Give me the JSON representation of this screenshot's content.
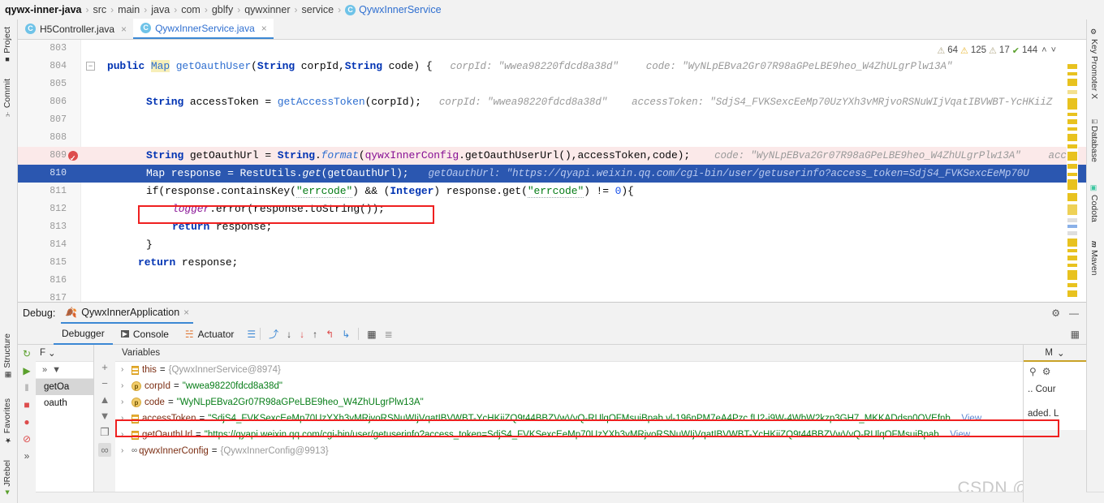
{
  "breadcrumb": {
    "items": [
      {
        "label": "qywx-inner-java",
        "kind": "root"
      },
      {
        "label": "src",
        "kind": "plain"
      },
      {
        "label": "main",
        "kind": "plain"
      },
      {
        "label": "java",
        "kind": "plain"
      },
      {
        "label": "com",
        "kind": "plain"
      },
      {
        "label": "gblfy",
        "kind": "plain"
      },
      {
        "label": "qywxinner",
        "kind": "plain"
      },
      {
        "label": "service",
        "kind": "plain"
      },
      {
        "label": "QywxInnerService",
        "kind": "class"
      }
    ],
    "separator": "›",
    "class_badge": "C"
  },
  "left_rail": [
    {
      "label": "Project",
      "icon": "project-icon",
      "glyph": "■"
    },
    {
      "label": "Commit",
      "icon": "commit-icon",
      "glyph": "⑂"
    },
    {
      "label": "Structure",
      "icon": "structure-icon",
      "glyph": "▦"
    },
    {
      "label": "Favorites",
      "icon": "star-icon",
      "glyph": "★"
    },
    {
      "label": "JRebel",
      "icon": "jrebel-icon",
      "glyph": "▲"
    }
  ],
  "right_rail": [
    {
      "label": "Key Promoter X",
      "icon": "key-promoter-icon",
      "glyph": "⚙"
    },
    {
      "label": "Database",
      "icon": "database-icon",
      "glyph": "⌸"
    },
    {
      "label": "Codota",
      "icon": "codota-icon",
      "glyph": "▣"
    },
    {
      "label": "Maven",
      "icon": "maven-icon",
      "glyph": "m"
    }
  ],
  "editor_tabs": [
    {
      "label": "H5Controller.java",
      "badge": "C",
      "active": false,
      "close": "×"
    },
    {
      "label": "QywxInnerService.java",
      "badge": "C",
      "active": true,
      "close": "×"
    }
  ],
  "inspections": {
    "grey_1": "64",
    "yellow": "125",
    "grey_2": "17",
    "green": "144",
    "up": "˄",
    "down": "˅",
    "triangle_glyph": "⚠",
    "check_glyph": "✔"
  },
  "code": {
    "lines": [
      {
        "n": "803",
        "segments": [],
        "hint": ""
      },
      {
        "n": "804",
        "fold": "−",
        "segments": [
          {
            "t": "public ",
            "c": "kw"
          },
          {
            "t": "Map",
            "c": "ty hl-map"
          },
          {
            "t": " ",
            "c": ""
          },
          {
            "t": "getOauthUser",
            "c": "mi"
          },
          {
            "t": "(",
            "c": ""
          },
          {
            "t": "String",
            "c": "kw"
          },
          {
            "t": "  corpId,",
            "c": ""
          },
          {
            "t": "String",
            "c": "kw"
          },
          {
            "t": " code) {",
            "c": ""
          }
        ],
        "hints": [
          {
            "t": "corpId:  \"wwea98220fdcd8a38d\"",
            "pad": 22
          },
          {
            "t": "code:  \"WyNLpEBva2Gr07R98aGPeLBE9heo_W4ZhULgrPlw13A\"",
            "pad": 34
          }
        ]
      },
      {
        "n": "805",
        "segments": [],
        "hint": ""
      },
      {
        "n": "806",
        "indent": 4,
        "segments": [
          {
            "t": "String",
            "c": "kw"
          },
          {
            "t": " accessToken = ",
            "c": ""
          },
          {
            "t": "getAccessToken",
            "c": "mi"
          },
          {
            "t": "(corpId);",
            "c": ""
          }
        ],
        "hints": [
          {
            "t": "corpId:  \"wwea98220fdcd8a38d\"",
            "pad": 22
          },
          {
            "t": "accessToken:  \"SdjS4_FVKSexcEeMp70UzYXh3vMRjvoRSNuWIjVqatIBVWBT-YcHKiiZ",
            "pad": 30
          }
        ]
      },
      {
        "n": "807",
        "segments": [],
        "hint": ""
      },
      {
        "n": "808",
        "segments": [],
        "hint": ""
      },
      {
        "n": "809",
        "error": true,
        "breakpoint": true,
        "indent": 4,
        "segments": [
          {
            "t": "String",
            "c": "kw"
          },
          {
            "t": " getOauthUrl = ",
            "c": ""
          },
          {
            "t": "String",
            "c": "kw"
          },
          {
            "t": ".",
            "c": ""
          },
          {
            "t": "format",
            "c": "mi itl"
          },
          {
            "t": "(",
            "c": ""
          },
          {
            "t": "qywxInnerConfig",
            "c": "fld"
          },
          {
            "t": ".getOauthUserUrl(),accessToken,code);",
            "c": ""
          }
        ],
        "hints": [
          {
            "t": "code:  \"WyNLpEBva2Gr07R98aGPeLBE9heo_W4ZhULgrPlw13A\"",
            "pad": 30
          },
          {
            "t": "acc",
            "pad": 34
          }
        ]
      },
      {
        "n": "810",
        "current": true,
        "indent": 4,
        "segments": [
          {
            "t": "Map",
            "c": "ty"
          },
          {
            "t": "  response = ",
            "c": ""
          },
          {
            "t": "RestUtils",
            "c": "ty"
          },
          {
            "t": ".",
            "c": ""
          },
          {
            "t": "get",
            "c": "mi itl"
          },
          {
            "t": "(getOauthUrl);",
            "c": ""
          }
        ],
        "hints": [
          {
            "t": "getOauthUrl:  \"https://qyapi.weixin.qq.com/cgi-bin/user/getuserinfo?access_token=SdjS4_FVKSexcEeMp70U",
            "pad": 24
          }
        ]
      },
      {
        "n": "811",
        "indent": 4,
        "segments": [
          {
            "t": "if(response.containsKey(",
            "c": ""
          },
          {
            "t": "\"errcode\"",
            "c": "st"
          },
          {
            "t": ") && (",
            "c": ""
          },
          {
            "t": "Integer",
            "c": "kw"
          },
          {
            "t": ") response.get(",
            "c": ""
          },
          {
            "t": "\"errcode\"",
            "c": "st"
          },
          {
            "t": ") != ",
            "c": ""
          },
          {
            "t": "0",
            "c": "num"
          },
          {
            "t": "){",
            "c": ""
          }
        ],
        "hints": []
      },
      {
        "n": "812",
        "indent": 8,
        "segments": [
          {
            "t": "logger",
            "c": "fld itl"
          },
          {
            "t": ".error(response.toString());",
            "c": ""
          }
        ],
        "hints": []
      },
      {
        "n": "813",
        "indent": 8,
        "segments": [
          {
            "t": "return",
            "c": "kw"
          },
          {
            "t": "  response;",
            "c": ""
          }
        ],
        "hints": []
      },
      {
        "n": "814",
        "indent": 4,
        "segments": [
          {
            "t": "}",
            "c": ""
          }
        ],
        "hints": []
      },
      {
        "n": "815",
        "indent": 4,
        "segments": [
          {
            "t": "return",
            "c": "kw"
          },
          {
            "t": "  response;",
            "c": ""
          }
        ],
        "hints": []
      },
      {
        "n": "816",
        "segments": [],
        "hints": []
      },
      {
        "n": "817",
        "segments": [],
        "hints": []
      }
    ]
  },
  "debug": {
    "title_label": "Debug:",
    "run_config": "QywxInnerApplication",
    "close_glyph": "×",
    "settings_glyph": "⚙",
    "minimize_glyph": "—",
    "tabs": [
      {
        "label": "Debugger",
        "icon": "debugger-icon",
        "glyph": "",
        "active": true
      },
      {
        "label": "Console",
        "icon": "console-icon",
        "glyph": "▶",
        "active": false
      },
      {
        "label": "Actuator",
        "icon": "actuator-icon",
        "glyph": "☵",
        "active": false
      }
    ],
    "toolbar_icons": [
      {
        "name": "layout-icon",
        "glyph": "☰",
        "color": "#3c88d4"
      },
      {
        "name": "step-over-icon",
        "glyph": "⤴",
        "color": "#3c88d4"
      },
      {
        "name": "step-into-icon",
        "glyph": "↓",
        "color": "#3c3c3c"
      },
      {
        "name": "force-step-into-icon",
        "glyph": "↓",
        "color": "#dd4c4c"
      },
      {
        "name": "step-out-icon",
        "glyph": "↑",
        "color": "#3c3c3c"
      },
      {
        "name": "drop-frame-icon",
        "glyph": "↰",
        "color": "#dd4c4c"
      },
      {
        "name": "run-to-cursor-icon",
        "glyph": "↳",
        "color": "#3c88d4"
      },
      {
        "name": "evaluate-icon",
        "glyph": "▦",
        "color": "#3c3c3c"
      },
      {
        "name": "settings-list-icon",
        "glyph": "≣",
        "color": "#9a9a9a"
      }
    ],
    "run_rail_icons": [
      {
        "name": "rerun-icon",
        "glyph": "↻",
        "color": "#5aa02c"
      },
      {
        "name": "resume-icon",
        "glyph": "▶",
        "color": "#5aa02c"
      },
      {
        "name": "pause-icon",
        "glyph": "‖",
        "color": "#8a8a8a"
      },
      {
        "name": "stop-icon",
        "glyph": "■",
        "color": "#dd4c4c"
      },
      {
        "name": "view-breakpoints-icon",
        "glyph": "●",
        "color": "#dd4c4c"
      },
      {
        "name": "mute-breakpoints-icon",
        "glyph": "⊘",
        "color": "#dd4c4c"
      },
      {
        "name": "more-icon",
        "glyph": "»",
        "color": "#555"
      }
    ],
    "frames": {
      "header_label": "F",
      "header_chevron": "⌄",
      "thread_more": "»",
      "thread_chevron": "▼",
      "items": [
        {
          "label": "getOa",
          "selected": true
        },
        {
          "label": "oauth",
          "selected": false
        }
      ]
    },
    "var_buttons": [
      {
        "name": "add-watch-icon",
        "glyph": "+"
      },
      {
        "name": "remove-watch-icon",
        "glyph": "−"
      },
      {
        "name": "move-up-icon",
        "glyph": "▲"
      },
      {
        "name": "move-down-icon",
        "glyph": "▼"
      },
      {
        "name": "copy-icon",
        "glyph": "❐"
      },
      {
        "name": "watches-icon",
        "glyph": "∞"
      }
    ],
    "variables": {
      "header": "Variables",
      "rows": [
        {
          "icon": "object-icon",
          "name": "this",
          "eq": " = ",
          "value": "{QywxInnerService@8974}",
          "value_kind": "obj",
          "arrow": "›"
        },
        {
          "icon": "param-icon",
          "name": "corpId",
          "eq": " = ",
          "value": "\"wwea98220fdcd8a38d\"",
          "value_kind": "str",
          "arrow": "›"
        },
        {
          "icon": "param-icon",
          "name": "code",
          "eq": " = ",
          "value": "\"WyNLpEBva2Gr07R98aGPeLBE9heo_W4ZhULgrPlw13A\"",
          "value_kind": "str",
          "arrow": "›"
        },
        {
          "icon": "object-icon",
          "name": "accessToken",
          "eq": " = ",
          "value": "\"SdjS4_FVKSexcEeMp70UzYXh3vMRjvoRSNuWIjVqatIBVWBT-YcHKiiZQ9t44BBZVwVvQ-RUlqOFMsuiBpab vl-196nPM7eA4Pzc fU2-i9W-4WbW2kzp3GH7_MKKADdsn0OVEfnb...",
          "value_kind": "str",
          "arrow": "›",
          "link": "View"
        },
        {
          "icon": "object-icon",
          "name": "getOauthUrl",
          "eq": " = ",
          "value": "\"https://qyapi.weixin.qq.com/cgi-bin/user/getuserinfo?access_token=SdjS4_FVKSexcEeMp70UzYXh3vMRjvoRSNuWIjVqatIBVWBT-YcHKiiZQ9t44BBZVwVvQ-RUlqOFMsuiBpab...",
          "value_kind": "str",
          "arrow": "›",
          "link": "View",
          "highlighted": true
        },
        {
          "icon": "oo-icon",
          "name": "qywxInnerConfig",
          "eq": " = ",
          "value": "{QywxInnerConfig@9913}",
          "value_kind": "obj",
          "arrow": "›"
        }
      ]
    },
    "side_panel": {
      "header_label": "M",
      "header_chevron": "⌄",
      "search_glyph": "⚲",
      "gear_glyph": "⚙",
      "row_prefix": "..",
      "row_label": "Cour",
      "note": "aded. L"
    }
  },
  "watermark": "CSDN @gblfy",
  "colors": {
    "accent_blue": "#3c88d4",
    "current_line": "#2b57b0",
    "error_bg": "#fbe9e9",
    "annotation_red": "#ef2020",
    "string_green": "#067d17",
    "keyword_blue": "#0033b3",
    "warning_yellow": "#e8c21f"
  }
}
